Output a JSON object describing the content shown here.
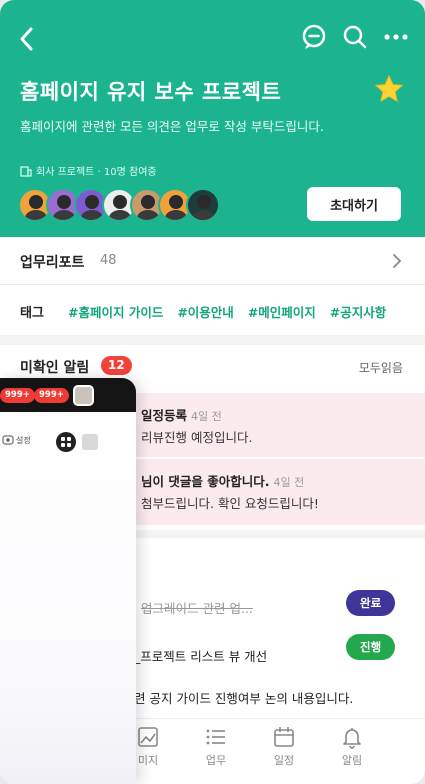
{
  "header": {
    "title": "홈페이지 유지 보수 프로젝트",
    "subtitle": "홈페이지에 관련한 모든 의견은 업무로 작성 부탁드립니다.",
    "meta": "회사 프로젝트 · 10명 참여중",
    "invite_label": "초대하기",
    "bg_color": "#1cb48e"
  },
  "avatars": [
    {
      "color": "#f0a23b"
    },
    {
      "color": "#9b6bd6"
    },
    {
      "color": "#7d5cd1"
    },
    {
      "color": "#ededed"
    },
    {
      "color": "#c99a6e"
    },
    {
      "color": "#f2a23c"
    },
    {
      "color": "#1f3b3a"
    }
  ],
  "report": {
    "label": "업무리포트",
    "count": "48"
  },
  "tags": {
    "label": "태그",
    "items": [
      "#홈페이지 가이드",
      "#이용안내",
      "#메인페이지",
      "#공지사항"
    ]
  },
  "unread": {
    "heading": "미확인 알림",
    "count": "12",
    "read_all": "모두읽음",
    "items": [
      {
        "title": "일정등록",
        "time": "4일 전",
        "body": "리뷰진행 예정입니다."
      },
      {
        "title": "님이 댓글을 좋아합니다.",
        "time": "4일 전",
        "body": "첨부드립니다. 확인 요청드립니다!"
      }
    ]
  },
  "tasks": [
    {
      "text": "업그레이드 관련 업...",
      "status": "완료"
    },
    {
      "text": "_프로젝트 리스트 뷰 개선",
      "status": "진행"
    },
    {
      "text": "련 공지 가이드 진행여부 논의 내용입니다.",
      "status": ""
    }
  ],
  "nav": [
    {
      "label": "미지",
      "icon": "image-icon"
    },
    {
      "label": "업무",
      "icon": "list-icon"
    },
    {
      "label": "일정",
      "icon": "calendar-icon"
    },
    {
      "label": "알림",
      "icon": "bell-icon"
    }
  ],
  "drawer": {
    "badge1": "999+",
    "badge2": "999+",
    "settings_label": "설정"
  }
}
